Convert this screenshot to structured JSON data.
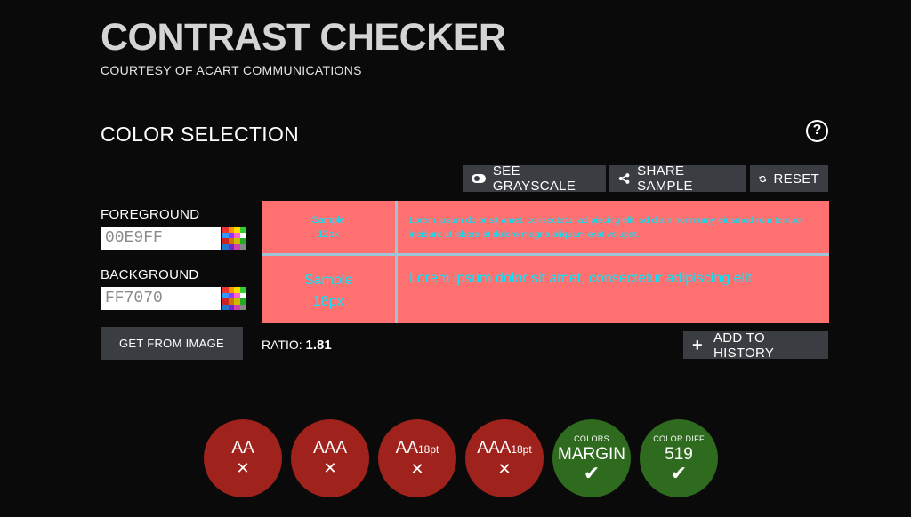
{
  "header": {
    "title": "CONTRAST CHECKER",
    "subtitle": "COURTESY OF ACART COMMUNICATIONS"
  },
  "section": {
    "title": "COLOR SELECTION",
    "help_icon": "?"
  },
  "toolbar": {
    "grayscale_label": "SEE GRAYSCALE",
    "share_label": "SHARE SAMPLE",
    "reset_label": "RESET"
  },
  "foreground": {
    "label": "FOREGROUND",
    "value": "00E9FF",
    "color": "#00E9FF"
  },
  "background": {
    "label": "BACKGROUND",
    "value": "FF7070",
    "color": "#FF7070"
  },
  "get_from_image_label": "GET FROM IMAGE",
  "sample": {
    "small_label_line1": "Sample",
    "small_label_line2": "12px",
    "small_text": "Lorem ipsum dolor sit amet, consectetur adipiscing elit, sd diam nonmumy eiusmod rom tempor incidunt ut lsbore et dolore magna aliquam erat volupat.",
    "large_label_line1": "Sample",
    "large_label_line2": "18px",
    "large_text": "Lorem ipsum dolor sit amet, consectetur adipiscing elit"
  },
  "ratio": {
    "label": "RATIO:",
    "value": "1.81"
  },
  "add_history_label": "ADD TO HISTORY",
  "badges": {
    "aa": {
      "main": "AA",
      "mark": "✕",
      "status": "fail"
    },
    "aaa": {
      "main": "AAA",
      "mark": "✕",
      "status": "fail"
    },
    "aa18": {
      "main": "AA",
      "sub": "18pt",
      "mark": "✕",
      "status": "fail"
    },
    "aaa18": {
      "main": "AAA",
      "sub": "18pt",
      "mark": "✕",
      "status": "fail"
    },
    "colors": {
      "small": "COLORS",
      "main": "MARGIN",
      "mark": "✔",
      "status": "pass"
    },
    "colordiff": {
      "small": "COLOR DIFF",
      "main": "519",
      "mark": "✔",
      "status": "pass"
    }
  },
  "colors": {
    "fail": "#A0221C",
    "pass": "#2F6B1E",
    "button_bg": "#3A3D42"
  }
}
